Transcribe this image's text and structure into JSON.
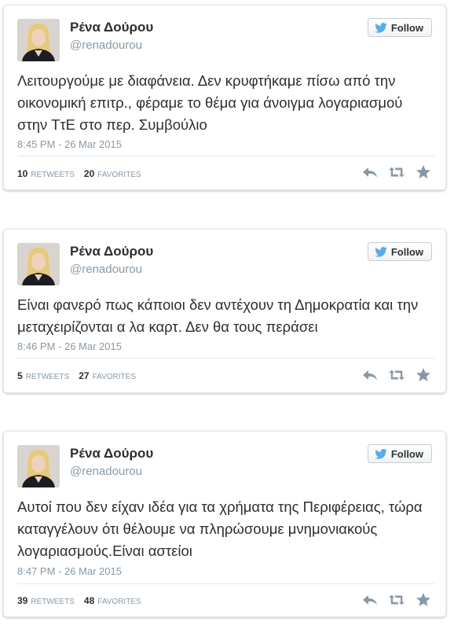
{
  "colors": {
    "name": "#292f33",
    "secondary": "#8899a6",
    "bird": "#55acee",
    "icon": "#8899a6"
  },
  "follow_label": "Follow",
  "tweets": [
    {
      "display_name": "Ρένα Δούρου",
      "screen_name": "@renadourou",
      "text": "Λειτουργούμε με διαφάνεια. Δεν κρυφτήκαμε πίσω από την οικονομική επιτρ., φέραμε το θέμα για άνοιγμα λογαριασμού στην ΤτΕ στο περ. Συμβούλιο",
      "timestamp": "8:45 PM - 26 Mar 2015",
      "retweets": "10",
      "retweets_label": "RETWEETS",
      "favorites": "20",
      "favorites_label": "FAVORITES"
    },
    {
      "display_name": "Ρένα Δούρου",
      "screen_name": "@renadourou",
      "text": "Είναι φανερό πως κάποιοι δεν αντέχουν τη Δημοκρατία και την μεταχειρίζονται α λα καρτ. Δεν θα τους περάσει",
      "timestamp": "8:46 PM - 26 Mar 2015",
      "retweets": "5",
      "retweets_label": "RETWEETS",
      "favorites": "27",
      "favorites_label": "FAVORITES"
    },
    {
      "display_name": "Ρένα Δούρου",
      "screen_name": "@renadourou",
      "text": "Αυτοί που δεν είχαν ιδέα για τα χρήματα της Περιφέρειας, τώρα καταγγέλουν ότι θέλουμε να πληρώσουμε μνημονιακούς λογαριασμούς.Είναι αστείοι",
      "timestamp": "8:47 PM - 26 Mar 2015",
      "retweets": "39",
      "retweets_label": "RETWEETS",
      "favorites": "48",
      "favorites_label": "FAVORITES"
    }
  ]
}
